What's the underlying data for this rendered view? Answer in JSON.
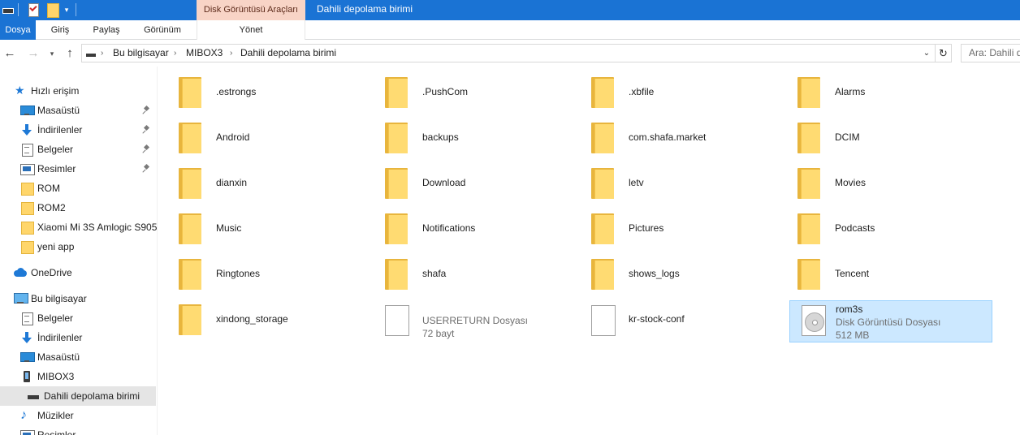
{
  "titlebar": {
    "context_tab_header": "Disk Görüntüsü Araçları",
    "window_title": "Dahili depolama birimi",
    "accent": "#1a73d4"
  },
  "ribbon": {
    "tabs": [
      {
        "label": "Dosya"
      },
      {
        "label": "Giriş"
      },
      {
        "label": "Paylaş"
      },
      {
        "label": "Görünüm"
      },
      {
        "label": "Yönet"
      }
    ]
  },
  "address": {
    "crumbs": [
      "Bu bilgisayar",
      "MIBOX3",
      "Dahili depolama birimi"
    ],
    "search_placeholder": "Ara: Dahili d"
  },
  "sidebar": {
    "items": [
      {
        "label": "Hızlı erişim",
        "icon": "star-icon"
      },
      {
        "label": "Masaüstü",
        "icon": "desktop-icon",
        "pinned": true
      },
      {
        "label": "İndirilenler",
        "icon": "download-icon",
        "pinned": true
      },
      {
        "label": "Belgeler",
        "icon": "documents-icon",
        "pinned": true
      },
      {
        "label": "Resimler",
        "icon": "pictures-icon",
        "pinned": true
      },
      {
        "label": "ROM",
        "icon": "folder-icon"
      },
      {
        "label": "ROM2",
        "icon": "folder-icon"
      },
      {
        "label": "Xiaomi Mi 3S  Amlogic S905",
        "icon": "folder-icon"
      },
      {
        "label": "yeni app",
        "icon": "folder-icon"
      },
      {
        "label": "OneDrive",
        "icon": "onedrive-icon"
      },
      {
        "label": "Bu bilgisayar",
        "icon": "computer-icon"
      },
      {
        "label": "Belgeler",
        "icon": "documents-icon"
      },
      {
        "label": "İndirilenler",
        "icon": "download-icon"
      },
      {
        "label": "Masaüstü",
        "icon": "desktop-icon"
      },
      {
        "label": "MIBOX3",
        "icon": "device-icon"
      },
      {
        "label": "Dahili depolama birimi",
        "icon": "drive-icon",
        "selected": true
      },
      {
        "label": "Müzikler",
        "icon": "music-icon"
      },
      {
        "label": "Resimler",
        "icon": "pictures-icon"
      }
    ]
  },
  "files": [
    {
      "name": ".estrongs",
      "type": "folder"
    },
    {
      "name": ".PushCom",
      "type": "folder"
    },
    {
      "name": ".xbfile",
      "type": "folder"
    },
    {
      "name": "Alarms",
      "type": "folder"
    },
    {
      "name": "Android",
      "type": "folder"
    },
    {
      "name": "backups",
      "type": "folder"
    },
    {
      "name": "com.shafa.market",
      "type": "folder"
    },
    {
      "name": "DCIM",
      "type": "folder"
    },
    {
      "name": "dianxin",
      "type": "folder"
    },
    {
      "name": "Download",
      "type": "folder"
    },
    {
      "name": "letv",
      "type": "folder"
    },
    {
      "name": "Movies",
      "type": "folder"
    },
    {
      "name": "Music",
      "type": "folder"
    },
    {
      "name": "Notifications",
      "type": "folder"
    },
    {
      "name": "Pictures",
      "type": "folder"
    },
    {
      "name": "Podcasts",
      "type": "folder"
    },
    {
      "name": "Ringtones",
      "type": "folder"
    },
    {
      "name": "shafa",
      "type": "folder"
    },
    {
      "name": "shows_logs",
      "type": "folder"
    },
    {
      "name": "Tencent",
      "type": "folder"
    },
    {
      "name": "xindong_storage",
      "type": "folder"
    },
    {
      "name": "USERRETURN Dosyası",
      "type": "file",
      "sub": "72 bayt"
    },
    {
      "name": "kr-stock-conf",
      "type": "file"
    },
    {
      "name": "rom3s",
      "type": "disc-image",
      "sub": "Disk Görüntüsü Dosyası",
      "sub2": "512 MB",
      "selected": true
    }
  ]
}
